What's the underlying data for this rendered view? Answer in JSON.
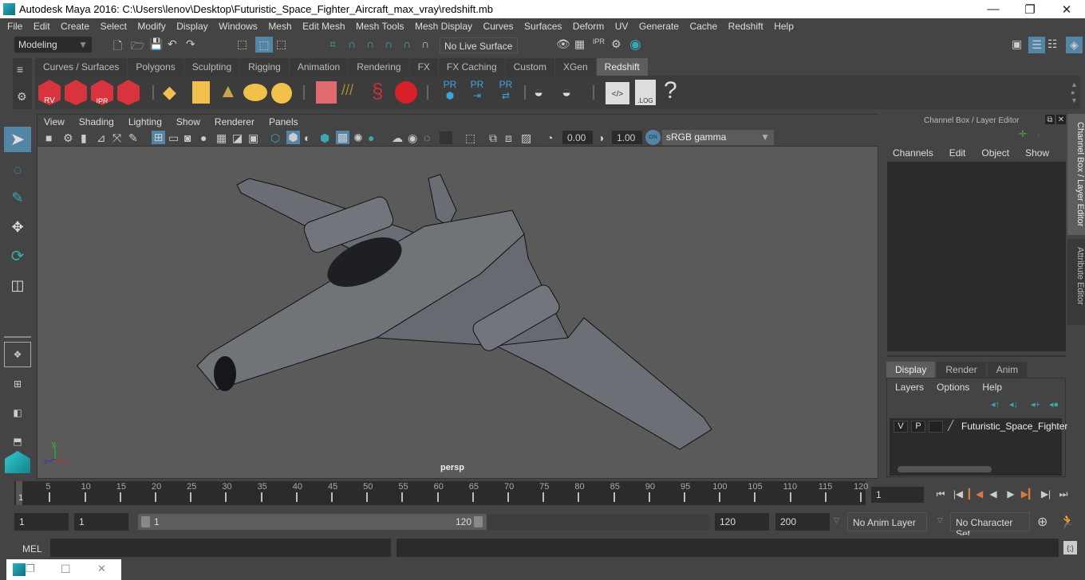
{
  "window": {
    "title": "Autodesk Maya 2016: C:\\Users\\lenov\\Desktop\\Futuristic_Space_Fighter_Aircraft_max_vray\\redshift.mb",
    "minimize": "—",
    "maximize": "❐",
    "close": "✕"
  },
  "menubar": [
    "File",
    "Edit",
    "Create",
    "Select",
    "Modify",
    "Display",
    "Windows",
    "Mesh",
    "Edit Mesh",
    "Mesh Tools",
    "Mesh Display",
    "Curves",
    "Surfaces",
    "Deform",
    "UV",
    "Generate",
    "Cache",
    "Redshift",
    "Help"
  ],
  "statusline": {
    "mode": "Modeling",
    "live_surface": "No Live Surface"
  },
  "shelf_tabs": [
    {
      "label": "Curves / Surfaces"
    },
    {
      "label": "Polygons"
    },
    {
      "label": "Sculpting"
    },
    {
      "label": "Rigging"
    },
    {
      "label": "Animation"
    },
    {
      "label": "Rendering"
    },
    {
      "label": "FX"
    },
    {
      "label": "FX Caching"
    },
    {
      "label": "Custom"
    },
    {
      "label": "XGen"
    },
    {
      "label": "Redshift",
      "active": true
    }
  ],
  "shelf_icons": {
    "rv": "RV",
    "ipr": "IPR",
    "pr": "PR",
    "log": ".LOG",
    "help": "?"
  },
  "viewport": {
    "menu": [
      "View",
      "Shading",
      "Lighting",
      "Show",
      "Renderer",
      "Panels"
    ],
    "exposure": "0.00",
    "gamma": "1.00",
    "color_mgmt_on": "ON",
    "color_space": "sRGB gamma",
    "camera": "persp",
    "axis": {
      "x": "x",
      "y": "y",
      "z": "z"
    }
  },
  "channel_box": {
    "title": "Channel Box / Layer Editor",
    "menu": [
      "Channels",
      "Edit",
      "Object",
      "Show"
    ]
  },
  "layer_editor": {
    "tabs": [
      "Display",
      "Render",
      "Anim"
    ],
    "active_tab": "Display",
    "menu": [
      "Layers",
      "Options",
      "Help"
    ],
    "layers": [
      {
        "v": "V",
        "p": "P",
        "name": "Futuristic_Space_Fighter"
      }
    ]
  },
  "side_tabs": [
    "Channel Box / Layer Editor",
    "Attribute Editor"
  ],
  "timeline": {
    "ticks": [
      5,
      10,
      15,
      20,
      25,
      30,
      35,
      40,
      45,
      50,
      55,
      60,
      65,
      70,
      75,
      80,
      85,
      90,
      95,
      100,
      105,
      110,
      115,
      120
    ],
    "current_label": "1",
    "current_frame": "1",
    "start": 1,
    "end": 120
  },
  "range": {
    "start_time": "1",
    "playback_start": "1",
    "range_start_label": "1",
    "range_end_label": "120",
    "playback_end": "120",
    "end_time": "200",
    "anim_layer": "No Anim Layer",
    "character_set": "No Character Set"
  },
  "command": {
    "label": "MEL",
    "input": ""
  },
  "taskbar": {
    "restore": "❐",
    "maximize": "☐",
    "close": "✕"
  }
}
